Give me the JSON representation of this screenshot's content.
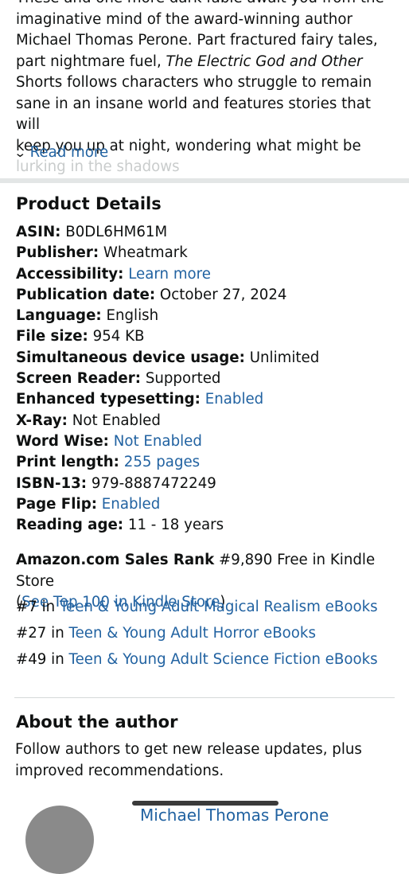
{
  "description": {
    "lines": [
      "These and one more dark fable await you from the",
      "imaginative mind of the award-winning author",
      "Michael Thomas Perone. Part fractured fairy tales,"
    ],
    "line4_prefix": "part nightmare fuel, ",
    "line4_italic": "The Electric God and Other",
    "lines_after": [
      "Shorts follows characters who struggle to remain",
      "sane in an insane world and features stories that will",
      "keep you up at night, wondering what might be"
    ],
    "faded_line": "lurking in the shadows",
    "read_more": "Read more"
  },
  "product_details": {
    "title": "Product Details",
    "rows": [
      {
        "key": "ASIN:",
        "value": "B0DL6HM61M",
        "is_link": false
      },
      {
        "key": "Publisher:",
        "value": "Wheatmark",
        "is_link": false
      },
      {
        "key": "Accessibility:",
        "value": "Learn more",
        "is_link": true
      },
      {
        "key": "Publication date:",
        "value": "October 27, 2024",
        "is_link": false
      },
      {
        "key": "Language:",
        "value": "English",
        "is_link": false
      },
      {
        "key": "File size:",
        "value": "954 KB",
        "is_link": false
      },
      {
        "key": "Simultaneous device usage:",
        "value": "Unlimited",
        "is_link": false
      },
      {
        "key": "Screen Reader:",
        "value": "Supported",
        "is_link": false
      },
      {
        "key": "Enhanced typesetting:",
        "value": "Enabled",
        "is_link": true
      },
      {
        "key": "X-Ray:",
        "value": "Not Enabled",
        "is_link": false
      },
      {
        "key": "Word Wise:",
        "value": "Not Enabled",
        "is_link": true
      },
      {
        "key": "Print length:",
        "value": "255 pages",
        "is_link": true
      },
      {
        "key": "ISBN-13:",
        "value": "979-8887472249",
        "is_link": false
      },
      {
        "key": "Page Flip:",
        "value": "Enabled",
        "is_link": true
      },
      {
        "key": "Reading age:",
        "value": "11 - 18 years",
        "is_link": false
      }
    ]
  },
  "sales_rank": {
    "label": "Amazon.com Sales Rank",
    "value": "#9,890 Free in Kindle Store",
    "open_paren": "(",
    "link": "See Top 100 in Kindle Store",
    "close_paren": ")",
    "categories": [
      {
        "rank": "#7 in",
        "link": "Teen & Young Adult Magical Realism eBooks"
      },
      {
        "rank": "#27 in",
        "link": "Teen & Young Adult Horror eBooks"
      },
      {
        "rank": "#49 in",
        "link": "Teen & Young Adult Science Fiction eBooks"
      }
    ]
  },
  "about_author": {
    "title": "About the author",
    "text": "Follow authors to get new release updates, plus improved recommendations.",
    "author_name": "Michael Thomas Perone"
  },
  "colors": {
    "link": "#2162a1",
    "text": "#0f1111",
    "divider": "#e3e6e6"
  }
}
